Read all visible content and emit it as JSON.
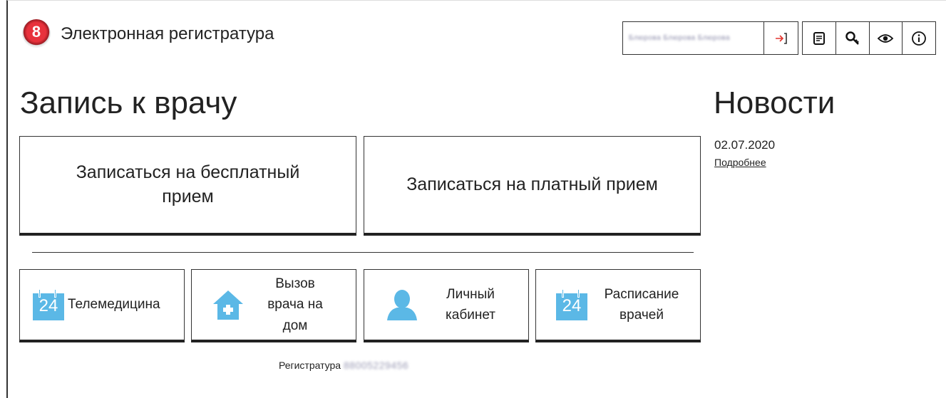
{
  "header": {
    "title": "Электронная регистратура",
    "logo_glyph": "8",
    "user_name": "Блюрова Блюрова Блюрова",
    "icons": [
      "login-icon",
      "document-icon",
      "search-key-icon",
      "eye-icon",
      "info-icon"
    ]
  },
  "main": {
    "heading": "Запись к врачу",
    "free_button": "Записаться на бесплатный прием",
    "paid_button": "Записаться на платный прием",
    "tiles": [
      {
        "label": "Телемедицина",
        "icon": "calendar-24-icon",
        "icon_text": "24"
      },
      {
        "label": "Вызов врача на дом",
        "icon": "house-plus-icon"
      },
      {
        "label": "Личный кабинет",
        "icon": "user-icon"
      },
      {
        "label": "Расписание врачей",
        "icon": "calendar-24-icon",
        "icon_text": "24"
      }
    ],
    "footer_label": "Регистратура",
    "footer_phone": "88005229456"
  },
  "news": {
    "heading": "Новости",
    "date": "02.07.2020",
    "more_link": "Подробнее"
  },
  "colors": {
    "accent_icon": "#5bb8e6",
    "login_icon": "#e2352e",
    "logo_red": "#d8262f"
  }
}
